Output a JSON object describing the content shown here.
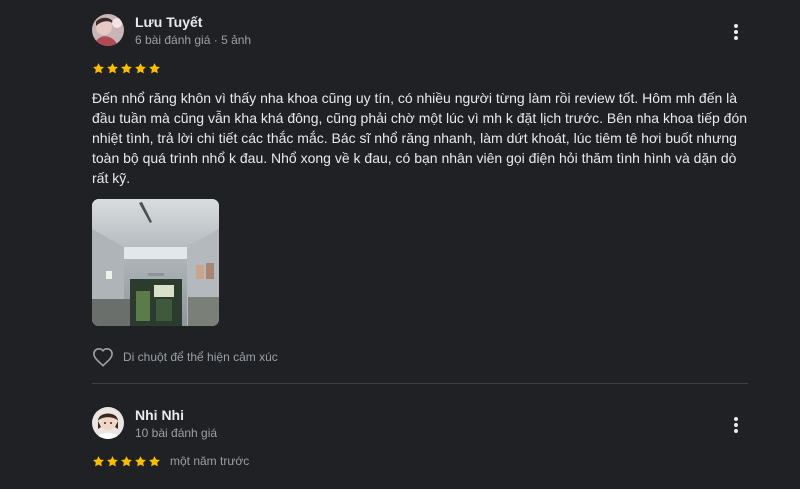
{
  "reviews": [
    {
      "author": "Lưu Tuyết",
      "meta": "6 bài đánh giá · 5 ảnh",
      "rating": 5,
      "time": "",
      "text": "Đến nhổ răng khôn vì thấy nha khoa cũng uy tín, có nhiều người từng làm rồi review tốt. Hôm mh đến là đầu tuần mà cũng vẫn kha khá đông, cũng phải chờ một lúc vì mh k đặt lịch trước. Bên nha khoa tiếp đón nhiệt tình, trả lời chi tiết các thắc mắc. Bác sĩ nhổ răng nhanh, làm dứt khoát, lúc tiêm tê hơi buốt nhưng toàn bộ quá trình nhổ k đau. Nhổ xong về k đau, có bạn nhân viên gọi điện hỏi thăm tình hình và dặn dò rất kỹ.",
      "reaction_label": "Di chuột để thể hiện cảm xúc"
    },
    {
      "author": "Nhi Nhi",
      "meta": "10 bài đánh giá",
      "rating": 5,
      "time": "một năm trước"
    }
  ],
  "colors": {
    "background": "#202124",
    "star": "#fbbc04",
    "text": "#e8eaed",
    "secondary_text": "#9aa0a6",
    "divider": "#3c4043"
  },
  "icons": {
    "more": "more-vert-icon",
    "star": "star-icon",
    "reaction": "heart-outline-icon"
  }
}
